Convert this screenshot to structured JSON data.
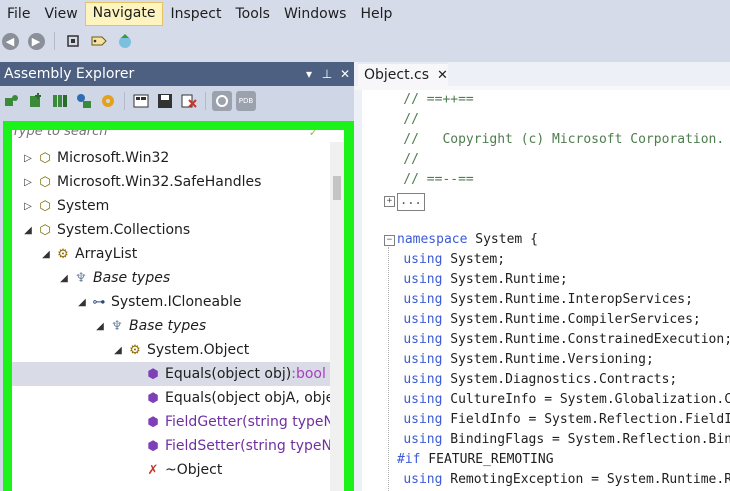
{
  "menu": [
    "File",
    "View",
    "Navigate",
    "Inspect",
    "Tools",
    "Windows",
    "Help"
  ],
  "menu_active": "Navigate",
  "toolbar_icons": [
    "back-icon",
    "forward-icon",
    "settings-icon",
    "tag-icon",
    "run-icon"
  ],
  "assembly_explorer": {
    "title": "Assembly Explorer",
    "controls": [
      "▾",
      "⊥",
      "✕"
    ],
    "search_placeholder": "Type to search",
    "tree": [
      {
        "label": "Microsoft.Win32",
        "arrow": "▷",
        "icon": "namespace-icon",
        "glyph": "⬡"
      },
      {
        "label": "Microsoft.Win32.SafeHandles",
        "arrow": "▷",
        "icon": "namespace-icon",
        "glyph": "⬡"
      },
      {
        "label": "System",
        "arrow": "▷",
        "icon": "namespace-icon",
        "glyph": "⬡"
      },
      {
        "label": "System.Collections",
        "arrow": "◢",
        "icon": "namespace-icon",
        "glyph": "⬡"
      },
      {
        "label": "ArrayList",
        "arrow": "◢",
        "icon": "class-icon",
        "glyph": "⚙"
      },
      {
        "label": "Base types",
        "arrow": "◢",
        "icon": "base-types-icon",
        "glyph": "♆"
      },
      {
        "label": "System.ICloneable",
        "arrow": "◢",
        "icon": "interface-icon",
        "glyph": "⊶"
      },
      {
        "label": "Base types",
        "arrow": "◢",
        "icon": "base-types-icon",
        "glyph": "♆"
      },
      {
        "label": "System.Object",
        "arrow": "◢",
        "icon": "class-icon",
        "glyph": "⚙"
      },
      {
        "label": "Equals(object obj)",
        "type": ":bool",
        "icon": "virtual-method-icon",
        "glyph": "⬢"
      },
      {
        "label": "Equals(object objA, object objB)",
        "icon": "method-icon",
        "glyph": "⬢"
      },
      {
        "label": "FieldGetter(string typeName, string fieldName, ref object val)",
        "icon": "private-method-icon",
        "glyph": "⬢"
      },
      {
        "label": "FieldSetter(string typeName, string fieldName, object val)",
        "icon": "private-method-icon",
        "glyph": "⬢"
      },
      {
        "label": "~Object",
        "icon": "destructor-icon",
        "glyph": "✗"
      }
    ],
    "selected_index": 9
  },
  "editor": {
    "tab_title": "Object.cs",
    "tab_close": "✕",
    "lines": [
      {
        "text": "    // ==++==",
        "kind": "comment"
      },
      {
        "text": "    //",
        "kind": "comment"
      },
      {
        "text": "    //   Copyright (c) Microsoft Corporation.  All rights reserved.",
        "kind": "comment"
      },
      {
        "text": "    //",
        "kind": "comment"
      },
      {
        "text": "    // ==--==",
        "kind": "comment"
      },
      {
        "text": "",
        "kind": "blank"
      },
      {
        "text": "",
        "kind": "blank"
      },
      {
        "text": "namespace System {",
        "kind": "ns"
      },
      {
        "text": "    using System;",
        "kind": "using"
      },
      {
        "text": "    using System.Runtime;",
        "kind": "using"
      },
      {
        "text": "    using System.Runtime.InteropServices;",
        "kind": "using"
      },
      {
        "text": "    using System.Runtime.CompilerServices;",
        "kind": "using"
      },
      {
        "text": "    using System.Runtime.ConstrainedExecution;",
        "kind": "using"
      },
      {
        "text": "    using System.Runtime.Versioning;",
        "kind": "using"
      },
      {
        "text": "    using System.Diagnostics.Contracts;",
        "kind": "using"
      },
      {
        "text": "    using CultureInfo = System.Globalization.CultureInfo;",
        "kind": "using"
      },
      {
        "text": "    using FieldInfo = System.Reflection.FieldInfo;",
        "kind": "using"
      },
      {
        "text": "    using BindingFlags = System.Reflection.BindingFlags;",
        "kind": "using"
      },
      {
        "text": "#if FEATURE_REMOTING",
        "kind": "pp"
      },
      {
        "text": "    using RemotingException = System.Runtime.Remoting.RemotingException;",
        "kind": "using"
      }
    ],
    "collapsed_marker": "...",
    "expand_glyph": "+",
    "collapse_glyph": "−"
  }
}
